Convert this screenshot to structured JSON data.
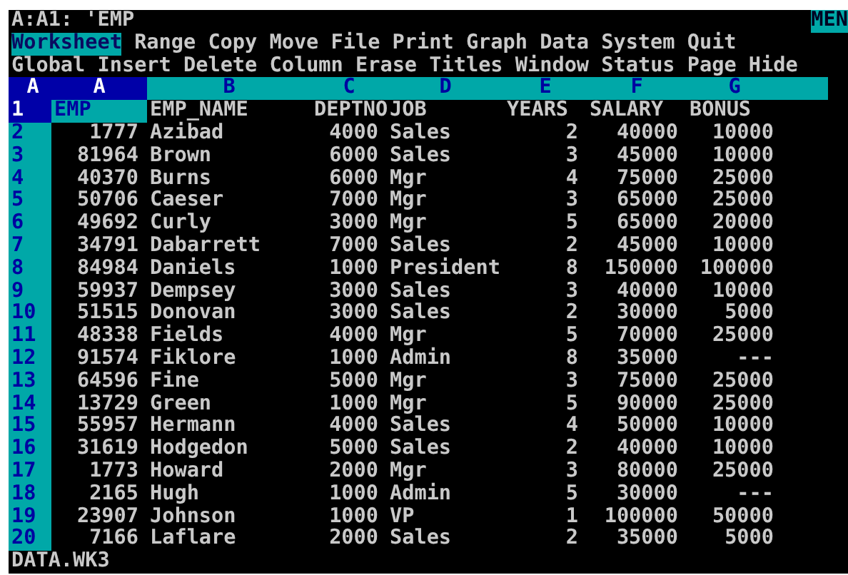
{
  "status_line": {
    "cell": "A:A1: 'EMP",
    "mode": "MEN"
  },
  "menu": [
    {
      "label": "Worksheet",
      "selected": true
    },
    {
      "label": "Range",
      "selected": false
    },
    {
      "label": "Copy",
      "selected": false
    },
    {
      "label": "Move",
      "selected": false
    },
    {
      "label": "File",
      "selected": false
    },
    {
      "label": "Print",
      "selected": false
    },
    {
      "label": "Graph",
      "selected": false
    },
    {
      "label": "Data",
      "selected": false
    },
    {
      "label": "System",
      "selected": false
    },
    {
      "label": "Quit",
      "selected": false
    }
  ],
  "submenu": [
    "Global",
    "Insert",
    "Delete",
    "Column",
    "Erase",
    "Titles",
    "Window",
    "Status",
    "Page",
    "Hide"
  ],
  "sheet": {
    "corner": "A",
    "columns": [
      {
        "label": "A",
        "selected": true
      },
      {
        "label": "B",
        "selected": false
      },
      {
        "label": "C",
        "selected": false
      },
      {
        "label": "D",
        "selected": false
      },
      {
        "label": "E",
        "selected": false
      },
      {
        "label": "F",
        "selected": false
      },
      {
        "label": "G",
        "selected": false
      }
    ],
    "rows": [
      {
        "number": "1",
        "selected": true,
        "cells": [
          "EMP",
          "EMP_NAME",
          "DEPTNO",
          "JOB",
          "YEARS",
          "SALARY",
          "BONUS"
        ]
      },
      {
        "number": "2",
        "selected": false,
        "cells": [
          "1777",
          "Azibad",
          "4000",
          "Sales",
          "2",
          "40000",
          "10000"
        ]
      },
      {
        "number": "3",
        "selected": false,
        "cells": [
          "81964",
          "Brown",
          "6000",
          "Sales",
          "3",
          "45000",
          "10000"
        ]
      },
      {
        "number": "4",
        "selected": false,
        "cells": [
          "40370",
          "Burns",
          "6000",
          "Mgr",
          "4",
          "75000",
          "25000"
        ]
      },
      {
        "number": "5",
        "selected": false,
        "cells": [
          "50706",
          "Caeser",
          "7000",
          "Mgr",
          "3",
          "65000",
          "25000"
        ]
      },
      {
        "number": "6",
        "selected": false,
        "cells": [
          "49692",
          "Curly",
          "3000",
          "Mgr",
          "5",
          "65000",
          "20000"
        ]
      },
      {
        "number": "7",
        "selected": false,
        "cells": [
          "34791",
          "Dabarrett",
          "7000",
          "Sales",
          "2",
          "45000",
          "10000"
        ]
      },
      {
        "number": "8",
        "selected": false,
        "cells": [
          "84984",
          "Daniels",
          "1000",
          "President",
          "8",
          "150000",
          "100000"
        ]
      },
      {
        "number": "9",
        "selected": false,
        "cells": [
          "59937",
          "Dempsey",
          "3000",
          "Sales",
          "3",
          "40000",
          "10000"
        ]
      },
      {
        "number": "10",
        "selected": false,
        "cells": [
          "51515",
          "Donovan",
          "3000",
          "Sales",
          "2",
          "30000",
          "5000"
        ]
      },
      {
        "number": "11",
        "selected": false,
        "cells": [
          "48338",
          "Fields",
          "4000",
          "Mgr",
          "5",
          "70000",
          "25000"
        ]
      },
      {
        "number": "12",
        "selected": false,
        "cells": [
          "91574",
          "Fiklore",
          "1000",
          "Admin",
          "8",
          "35000",
          "---"
        ]
      },
      {
        "number": "13",
        "selected": false,
        "cells": [
          "64596",
          "Fine",
          "5000",
          "Mgr",
          "3",
          "75000",
          "25000"
        ]
      },
      {
        "number": "14",
        "selected": false,
        "cells": [
          "13729",
          "Green",
          "1000",
          "Mgr",
          "5",
          "90000",
          "25000"
        ]
      },
      {
        "number": "15",
        "selected": false,
        "cells": [
          "55957",
          "Hermann",
          "4000",
          "Sales",
          "4",
          "50000",
          "10000"
        ]
      },
      {
        "number": "16",
        "selected": false,
        "cells": [
          "31619",
          "Hodgedon",
          "5000",
          "Sales",
          "2",
          "40000",
          "10000"
        ]
      },
      {
        "number": "17",
        "selected": false,
        "cells": [
          "1773",
          "Howard",
          "2000",
          "Mgr",
          "3",
          "80000",
          "25000"
        ]
      },
      {
        "number": "18",
        "selected": false,
        "cells": [
          "2165",
          "Hugh",
          "1000",
          "Admin",
          "5",
          "30000",
          "---"
        ]
      },
      {
        "number": "19",
        "selected": false,
        "cells": [
          "23907",
          "Johnson",
          "1000",
          "VP",
          "1",
          "100000",
          "50000"
        ]
      },
      {
        "number": "20",
        "selected": false,
        "cells": [
          "7166",
          "Laflare",
          "2000",
          "Sales",
          "2",
          "35000",
          "5000"
        ]
      }
    ]
  },
  "file_name": "DATA.WK3"
}
